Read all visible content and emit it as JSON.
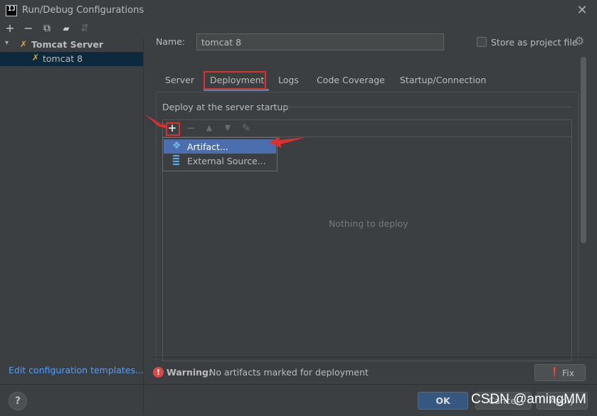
{
  "window": {
    "title": "Run/Debug Configurations",
    "app_icon_text": "IJ"
  },
  "left_toolbar": {
    "icons": [
      "add-icon",
      "remove-icon",
      "copy-icon",
      "folder-add-icon",
      "sort-icon"
    ],
    "add_glyph": "+",
    "remove_glyph": "−",
    "copy_glyph": "⧉",
    "folder_glyph": "▰",
    "sort_glyph": "⇵"
  },
  "tree": {
    "group_label": "Tomcat Server",
    "group_expand_glyph": "▾",
    "group_icon_glyph": "✗",
    "item_label": "tomcat 8",
    "item_icon_glyph": "✗"
  },
  "edit_templates_link": "Edit configuration templates...",
  "name_field": {
    "label": "Name:",
    "value": "tomcat 8"
  },
  "store_as_project_file": {
    "label": "Store as project file",
    "checked": false,
    "gear_glyph": "⚙"
  },
  "tabs": [
    {
      "label": "Server",
      "active": false
    },
    {
      "label": "Deployment",
      "active": true
    },
    {
      "label": "Logs",
      "active": false
    },
    {
      "label": "Code Coverage",
      "active": false
    },
    {
      "label": "Startup/Connection",
      "active": false
    }
  ],
  "deploy_section": {
    "title": "Deploy at the server startup",
    "empty_text": "Nothing to deploy",
    "toolbar": {
      "add_glyph": "+",
      "remove_glyph": "−",
      "up_glyph": "▲",
      "down_glyph": "▼",
      "edit_glyph": "✎"
    }
  },
  "popup_menu": {
    "items": [
      {
        "label": "Artifact...",
        "icon": "artifact-icon",
        "glyph": "❖",
        "selected": true
      },
      {
        "label": "External Source...",
        "icon": "external-source-icon",
        "selected": false
      }
    ]
  },
  "warning": {
    "icon_glyph": "!",
    "bold": "Warning:",
    "text": "No artifacts marked for deployment",
    "fix_label": "Fix",
    "fix_icon_glyph": "❗"
  },
  "buttons": {
    "help": "?",
    "ok": "OK",
    "cancel": "Cancel",
    "apply": "Apply"
  },
  "watermark": "CSDN @amingMM",
  "colors": {
    "background": "#3c3f41",
    "selection": "#0d293e",
    "popup_selected": "#4b6eaf",
    "link": "#589df6",
    "annotation_red": "#e0302e",
    "ok_button": "#365880"
  }
}
